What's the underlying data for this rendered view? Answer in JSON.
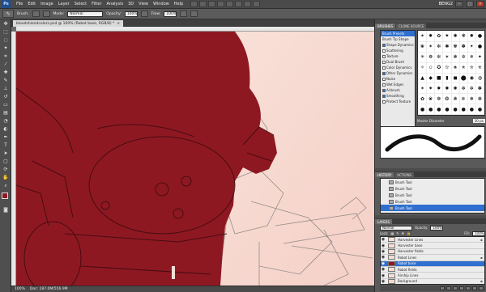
{
  "app": {
    "logo": "Ps",
    "menu": [
      "File",
      "Edit",
      "Image",
      "Layer",
      "Select",
      "Filter",
      "Analysis",
      "3D",
      "View",
      "Window",
      "Help"
    ],
    "workspace": "BENG2"
  },
  "options_bar": {
    "brush_label": "Brush:",
    "mode_label": "Mode:",
    "mode_value": "Normal",
    "opacity_label": "Opacity:",
    "opacity_value": "100%",
    "flow_label": "Flow:",
    "flow_value": "100%"
  },
  "document": {
    "tab_title": "bloodshiendcolors.psd @ 100% (Robot base, RGB/8) *",
    "status": "Doc: 187.0M/556.9M",
    "foreground_color": "#8e1822",
    "background_color": "#ffffff",
    "fill_color": "#8e1822"
  },
  "panels": {
    "brushes": {
      "tabs": [
        "BRUSHES",
        "CLONE SOURCE"
      ],
      "options": [
        {
          "label": "Brush Presets",
          "active": true,
          "checked": false
        },
        {
          "label": "Brush Tip Shape",
          "active": false,
          "checked": false
        },
        {
          "label": "Shape Dynamics",
          "active": false,
          "checked": true
        },
        {
          "label": "Scattering",
          "active": false,
          "checked": false
        },
        {
          "label": "Texture",
          "active": false,
          "checked": false
        },
        {
          "label": "Dual Brush",
          "active": false,
          "checked": false
        },
        {
          "label": "Color Dynamics",
          "active": false,
          "checked": false
        },
        {
          "label": "Other Dynamics",
          "active": false,
          "checked": true
        },
        {
          "label": "Noise",
          "active": false,
          "checked": false
        },
        {
          "label": "Wet Edges",
          "active": false,
          "checked": false
        },
        {
          "label": "Airbrush",
          "active": false,
          "checked": true
        },
        {
          "label": "Smoothing",
          "active": false,
          "checked": true
        },
        {
          "label": "Protect Texture",
          "active": false,
          "checked": false
        }
      ],
      "master_diameter_label": "Master Diameter",
      "master_diameter_value": "30 px"
    },
    "history": {
      "tabs": [
        "HISTORY",
        "ACTIONS"
      ],
      "items": [
        "Brush Tool",
        "Brush Tool",
        "Brush Tool",
        "Brush Tool",
        "Brush Tool"
      ],
      "active_index": 4
    },
    "layers": {
      "tabs": [
        "LAYERS"
      ],
      "blend_mode": "Normal",
      "opacity_label": "Opacity:",
      "opacity_value": "100%",
      "lock_label": "Lock:",
      "fill_label": "Fill:",
      "fill_value": "100%",
      "items": [
        {
          "name": "Harvester Lines",
          "active": false,
          "locked": true
        },
        {
          "name": "Harvester base",
          "active": false,
          "locked": false
        },
        {
          "name": "Harvester fields",
          "active": false,
          "locked": false
        },
        {
          "name": "Robot Lines",
          "active": false,
          "locked": true
        },
        {
          "name": "Robot base",
          "active": true,
          "locked": false
        },
        {
          "name": "Robot fields",
          "active": false,
          "locked": false
        },
        {
          "name": "Airship Lines",
          "active": false,
          "locked": false
        },
        {
          "name": "Background",
          "active": false,
          "locked": true
        }
      ]
    }
  }
}
